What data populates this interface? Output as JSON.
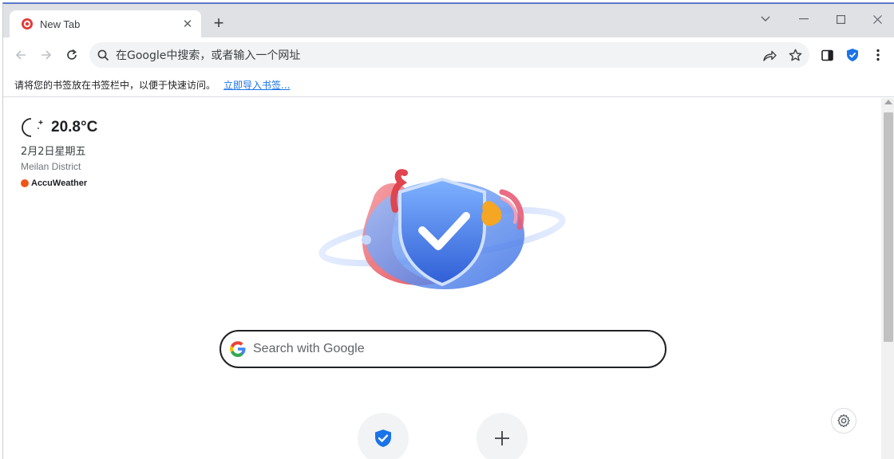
{
  "tab": {
    "title": "New Tab",
    "close_label": "✕",
    "new_tab_label": "+"
  },
  "window_controls": {
    "collapse_label": "⌄",
    "minimize_label": "—",
    "maximize_label": "☐",
    "close_label": "✕"
  },
  "omnibox": {
    "placeholder": "在Google中搜索，或者输入一个网址"
  },
  "bookmarks_bar": {
    "message": "请将您的书签放在书签栏中，以便于快速访问。",
    "import_link": "立即导入书签..."
  },
  "weather": {
    "temperature": "20.8°C",
    "date": "2月2日星期五",
    "district": "Meilan District",
    "provider": "AccuWeather"
  },
  "search": {
    "placeholder": "Search with Google"
  },
  "colors": {
    "accent": "#1a73e8",
    "tab_strip": "#dfe1e5",
    "omnibox_bg": "#f1f3f4",
    "accuweather": "#f05514"
  },
  "icons": [
    "back-arrow-icon",
    "forward-arrow-icon",
    "reload-icon",
    "search-icon",
    "share-icon",
    "star-icon",
    "side-panel-icon",
    "shield-icon",
    "more-menu-icon",
    "moon-icon",
    "google-g-icon",
    "plus-icon",
    "gear-icon"
  ]
}
